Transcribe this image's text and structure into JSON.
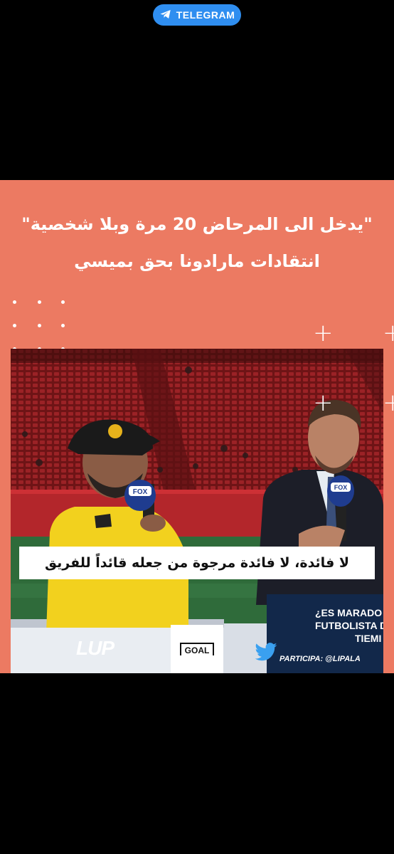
{
  "badge": {
    "label": "TELEGRAM",
    "icon": "telegram-icon"
  },
  "post": {
    "headline_line1": "\"يدخل الى المرحاض 20 مرة وبلا شخصية\"",
    "headline_line2": "انتقادات مارادونا بحق بميسي",
    "background_color": "#ec7a62"
  },
  "video": {
    "subtitle": "لا فائدة، لا فائدة مرجوة من جعله قائداً للفريق",
    "lup_logo": "LUP",
    "goal_logo": "GOAL",
    "mic_label": "FOX",
    "fox_overlay_line1": "¿ES MARADO",
    "fox_overlay_line2": "FUTBOLISTA D",
    "fox_overlay_line3": "TIEMI",
    "fox_overlay_bottom": "PARTICIPA: @LIPALA"
  }
}
